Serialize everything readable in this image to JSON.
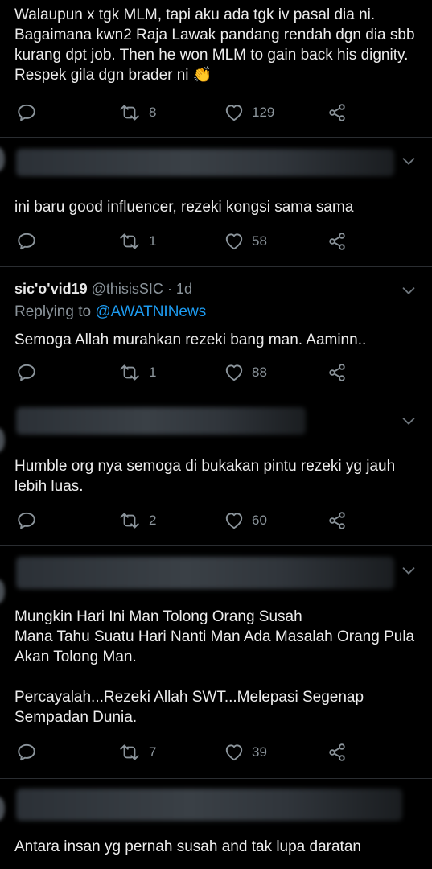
{
  "tweets": [
    {
      "text": "Walaupun x tgk MLM, tapi aku ada tgk iv pasal dia ni. Bagaimana kwn2 Raja Lawak pandang rendah dgn dia sbb kurang dpt job. Then he won MLM to gain back his dignity. Respek gila dgn brader ni",
      "emoji": "👏",
      "retweets": "8",
      "likes": "129"
    },
    {
      "text": "ini baru good influencer, rezeki kongsi sama sama",
      "retweets": "1",
      "likes": "58"
    },
    {
      "display_name": "sic'o'vid19",
      "handle": "@thisisSIC",
      "time": "· 1d",
      "replying_prefix": "Replying to ",
      "replying_to": "@AWATNINews",
      "text": "Semoga Allah murahkan rezeki bang man. Aaminn..",
      "retweets": "1",
      "likes": "88"
    },
    {
      "text": "Humble org nya semoga di bukakan pintu rezeki yg jauh lebih luas.",
      "retweets": "2",
      "likes": "60"
    },
    {
      "text": "Mungkin Hari Ini Man Tolong Orang Susah\nMana Tahu Suatu Hari Nanti Man Ada Masalah Orang Pula Akan Tolong Man.\n\nPercayalah...Rezeki Allah SWT...Melepasi Segenap Sempadan Dunia.",
      "retweets": "7",
      "likes": "39"
    },
    {
      "text": "Antara insan yg pernah susah and tak lupa daratan"
    }
  ],
  "icons": {
    "reply": "reply-icon",
    "retweet": "retweet-icon",
    "like": "heart-icon",
    "share": "share-icon",
    "more": "chevron-down-icon"
  },
  "colors": {
    "background": "#000000",
    "divider": "#2a2d31",
    "muted": "#8b949b",
    "link": "#1d9bf0"
  }
}
